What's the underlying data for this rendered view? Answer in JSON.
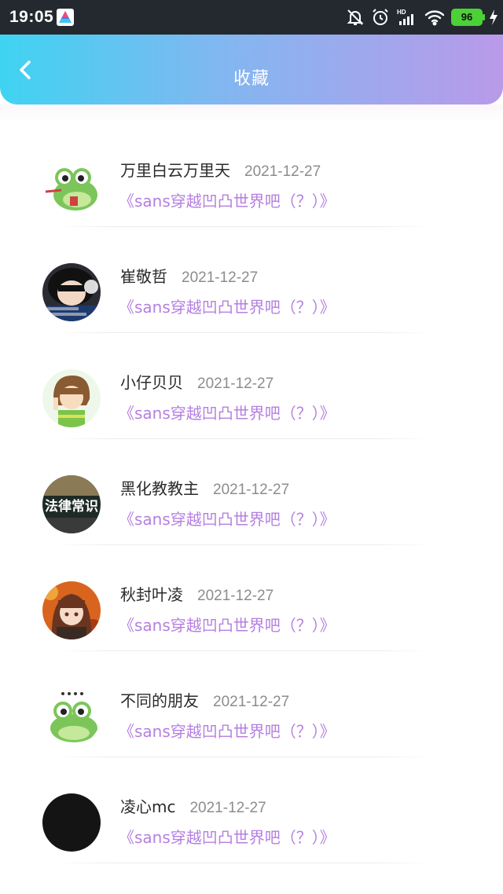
{
  "status_bar": {
    "time": "19:05",
    "battery": "96"
  },
  "header": {
    "title": "收藏"
  },
  "favorites": [
    {
      "name": "万里白云万里天",
      "date": "2021-12-27",
      "work": "《sans穿越凹凸世界吧（？）》"
    },
    {
      "name": "崔敬哲",
      "date": "2021-12-27",
      "work": "《sans穿越凹凸世界吧（？）》"
    },
    {
      "name": "小仔贝贝",
      "date": "2021-12-27",
      "work": "《sans穿越凹凸世界吧（？）》"
    },
    {
      "name": "黑化教教主",
      "date": "2021-12-27",
      "work": "《sans穿越凹凸世界吧（？）》"
    },
    {
      "name": "秋封叶凌",
      "date": "2021-12-27",
      "work": "《sans穿越凹凸世界吧（？）》"
    },
    {
      "name": "不同的朋友",
      "date": "2021-12-27",
      "work": "《sans穿越凹凸世界吧（？）》"
    },
    {
      "name": "凌心mc",
      "date": "2021-12-27",
      "work": "《sans穿越凹凸世界吧（？）》"
    }
  ],
  "avatar_text": {
    "book_title": "法律常识"
  },
  "colors": {
    "accent": "#b57fe0",
    "header_start": "#3fd3f2",
    "header_end": "#b99ae9"
  }
}
